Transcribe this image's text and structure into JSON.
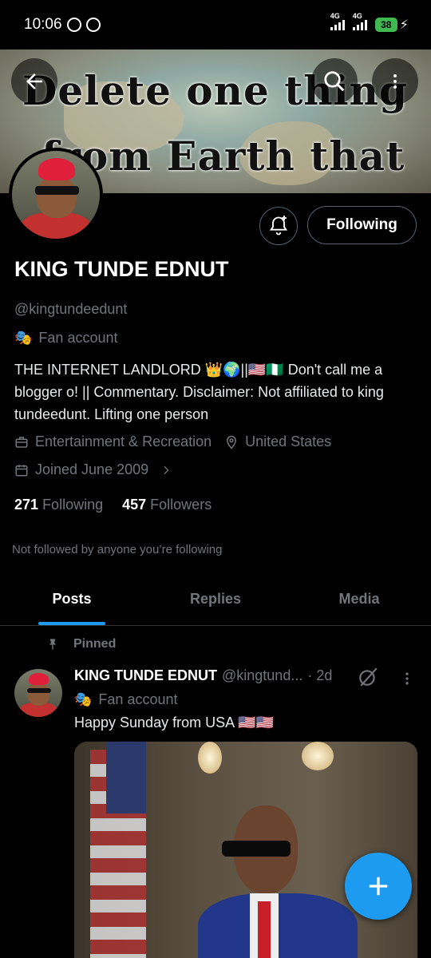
{
  "status_bar": {
    "time": "10:06",
    "net1": "4G",
    "net2": "4G",
    "battery": "38"
  },
  "banner": {
    "line1": "Delete one thing",
    "line2": "from Earth that"
  },
  "profile": {
    "name": "KING TUNDE EDNUT",
    "handle": "@kingtundeedunt",
    "label": "Fan account",
    "bio": "THE INTERNET LANDLORD 👑🌍||🇺🇸🇳🇬 Don't call me a blogger o! || Commentary. Disclaimer: Not affiliated to king tundeedunt. Lifting one person",
    "category": "Entertainment & Recreation",
    "location": "United States",
    "joined": "Joined June 2009",
    "following_count": "271",
    "following_label": "Following",
    "followers_count": "457",
    "followers_label": "Followers",
    "not_followed": "Not followed by anyone you’re following"
  },
  "actions": {
    "following_button": "Following"
  },
  "tabs": [
    {
      "label": "Posts"
    },
    {
      "label": "Replies"
    },
    {
      "label": "Media"
    }
  ],
  "post": {
    "pinned_label": "Pinned",
    "author": "KING TUNDE EDNUT",
    "handle": "@kingtund...",
    "time": "· 2d",
    "label": "Fan account",
    "text": "Happy Sunday from USA 🇺🇸🇺🇸"
  },
  "colors": {
    "accent": "#1d9bf0",
    "background": "#000000",
    "muted": "#71767b"
  },
  "icons": [
    "back-arrow-icon",
    "search-icon",
    "more-vertical-icon",
    "bell-plus-icon",
    "mask-icon",
    "briefcase-icon",
    "location-pin-icon",
    "calendar-icon",
    "pin-icon",
    "grok-icon",
    "compose-plus-icon"
  ]
}
